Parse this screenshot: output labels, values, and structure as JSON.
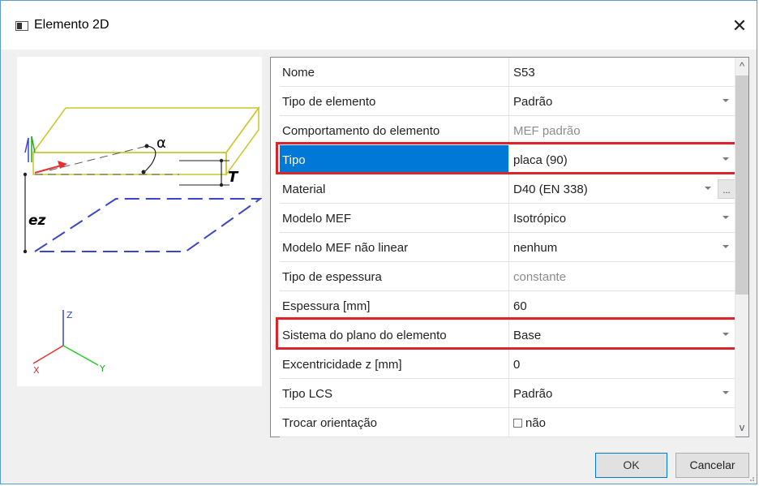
{
  "window": {
    "title": "Elemento 2D",
    "close_glyph": "✕"
  },
  "preview": {
    "labels": {
      "alpha": "α",
      "thickness": "T",
      "eccentricity": "ez"
    },
    "axes": {
      "z": "Z",
      "x": "X",
      "y": "Y"
    }
  },
  "properties": [
    {
      "label": "Nome",
      "value": "S53",
      "dropdown": false,
      "readonly": false
    },
    {
      "label": "Tipo de elemento",
      "value": "Padrão",
      "dropdown": true,
      "readonly": false
    },
    {
      "label": "Comportamento do elemento",
      "value": "MEF padrão",
      "dropdown": false,
      "readonly": true
    },
    {
      "label": "Tipo",
      "value": "placa (90)",
      "dropdown": true,
      "readonly": false,
      "selected": true,
      "highlighted": true
    },
    {
      "label": "Material",
      "value": "D40 (EN 338)",
      "dropdown": true,
      "readonly": false,
      "ellipsis": "..."
    },
    {
      "label": "Modelo MEF",
      "value": "Isotrópico",
      "dropdown": true,
      "readonly": false
    },
    {
      "label": "Modelo MEF não linear",
      "value": "nenhum",
      "dropdown": true,
      "readonly": false
    },
    {
      "label": "Tipo de espessura",
      "value": "constante",
      "dropdown": false,
      "readonly": true
    },
    {
      "label": "Espessura [mm]",
      "value": "60",
      "dropdown": false,
      "readonly": false
    },
    {
      "label": "Sistema do plano do elemento",
      "value": "Base",
      "dropdown": true,
      "readonly": false,
      "highlighted": true
    },
    {
      "label": "Excentricidade z [mm]",
      "value": "0",
      "dropdown": false,
      "readonly": false
    },
    {
      "label": "Tipo LCS",
      "value": "Padrão",
      "dropdown": true,
      "readonly": false
    },
    {
      "label": "Trocar orientação",
      "value": "não",
      "dropdown": false,
      "readonly": false,
      "checkbox": true,
      "checked": false
    }
  ],
  "scrollbar": {
    "up_glyph": "^",
    "down_glyph": "v"
  },
  "buttons": {
    "ok": "OK",
    "cancel": "Cancelar"
  },
  "colors": {
    "selection": "#0078d7",
    "highlight": "#d9252b",
    "plate": "#c8c828",
    "plane": "#3a45c8"
  }
}
